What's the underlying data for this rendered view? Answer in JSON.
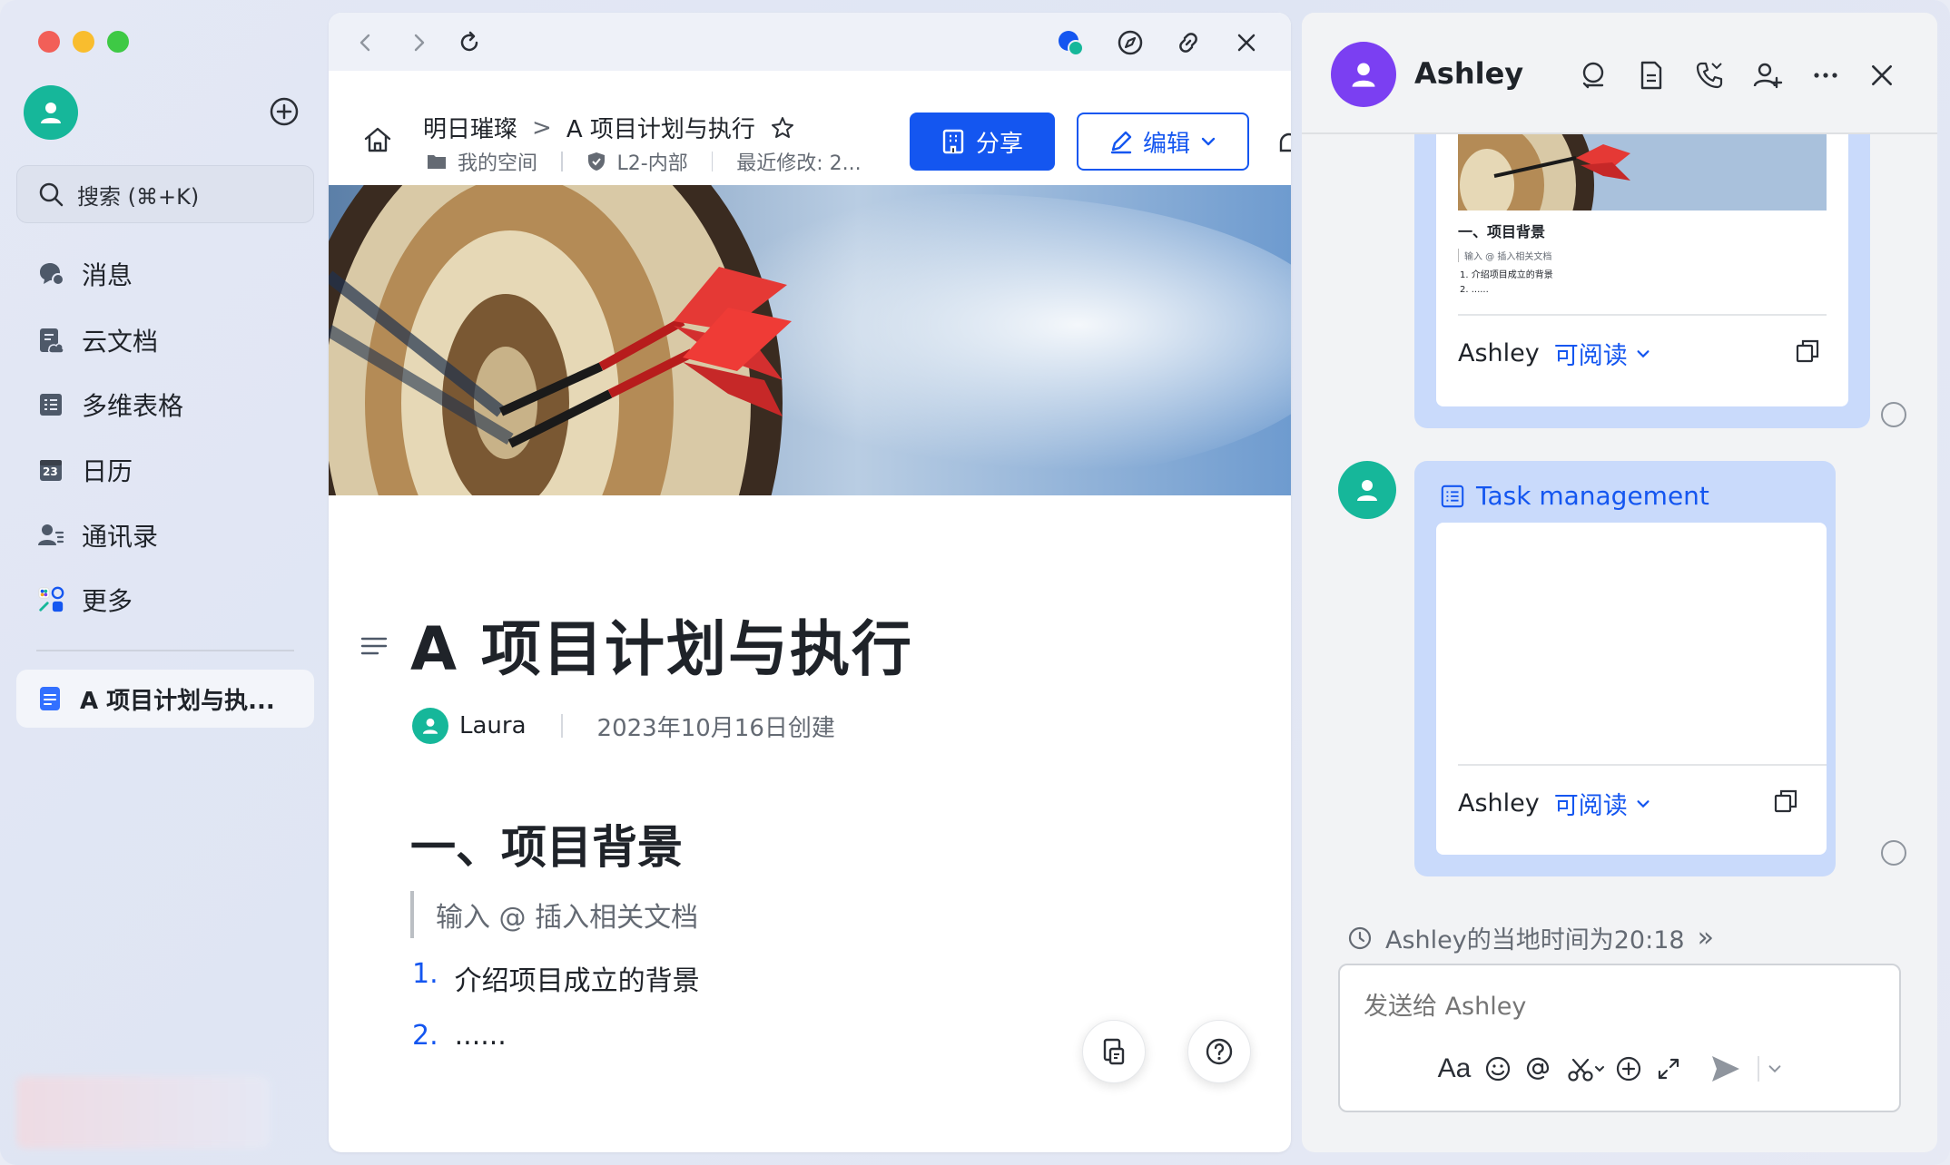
{
  "sidebar": {
    "search": "搜索 (⌘+K)",
    "items": [
      {
        "label": "消息",
        "icon": "chat-bubbles-icon"
      },
      {
        "label": "云文档",
        "icon": "cloud-doc-icon"
      },
      {
        "label": "多维表格",
        "icon": "table-icon"
      },
      {
        "label": "日历",
        "icon": "calendar-icon"
      },
      {
        "label": "通讯录",
        "icon": "contacts-icon"
      },
      {
        "label": "更多",
        "icon": "apps-grid-icon"
      }
    ],
    "calendar_day": "23",
    "recent_doc": "A 项目计划与执..."
  },
  "doc": {
    "breadcrumb_parent": "明日璀璨",
    "breadcrumb_sep": ">",
    "breadcrumb_current": "A 项目计划与执行",
    "location": "我的空间",
    "security": "L2-内部",
    "last_modified": "最近修改: 2...",
    "share_label": "分享",
    "edit_label": "编辑",
    "title": "A 项目计划与执行",
    "author": "Laura",
    "created": "2023年10月16日创建",
    "heading": "一、项目背景",
    "quote": "输入 @ 插入相关文档",
    "list": [
      {
        "num": "1.",
        "text": "介绍项目成立的背景"
      },
      {
        "num": "2.",
        "text": "......"
      }
    ]
  },
  "chat": {
    "name": "Ashley",
    "card1": {
      "heading": "一、项目背景",
      "line1": "输入 @ 插入相关文档",
      "line2": "1. 介绍项目成立的背景",
      "line3": "2. ......",
      "owner": "Ashley",
      "permission": "可阅读"
    },
    "card2": {
      "title": "Task management",
      "owner": "Ashley",
      "permission": "可阅读"
    },
    "local_time": "Ashley的当地时间为20:18",
    "local_time_arrow": "»",
    "input_placeholder": "发送给 Ashley",
    "format_label": "Aa"
  },
  "colors": {
    "brand_blue": "#1456f0",
    "avatar_green": "#16b79a",
    "avatar_purple": "#7b3ff2",
    "bubble": "#c9dafb"
  }
}
